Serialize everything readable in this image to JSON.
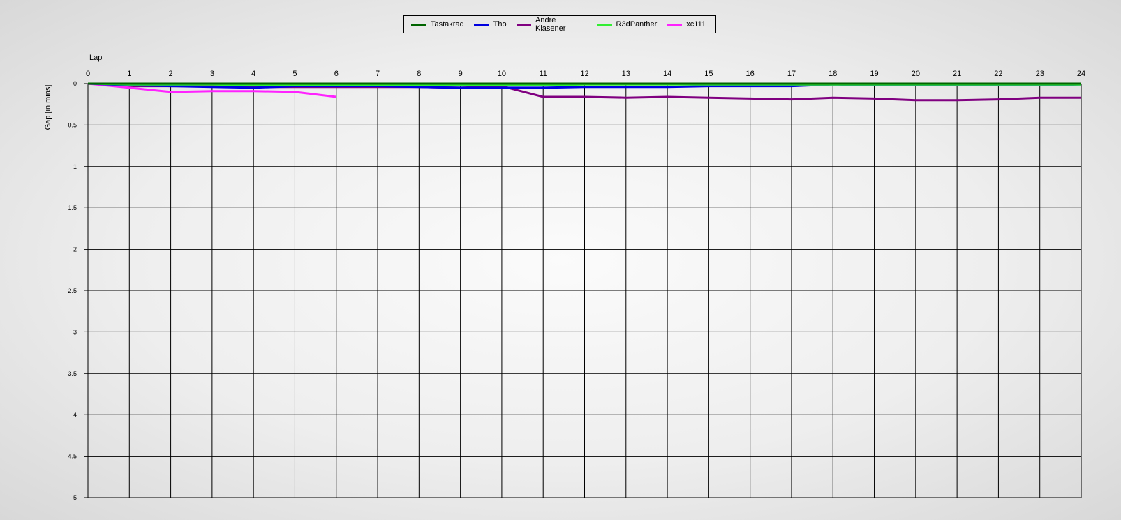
{
  "chart_data": {
    "type": "line",
    "xlabel": "Lap",
    "ylabel": "Gap [in mins]",
    "x_ticks": [
      0,
      1,
      2,
      3,
      4,
      5,
      6,
      7,
      8,
      9,
      10,
      11,
      12,
      13,
      14,
      15,
      16,
      17,
      18,
      19,
      20,
      21,
      22,
      23,
      24
    ],
    "x_tick_labels": [
      "0",
      "1",
      "2",
      "3",
      "4",
      "5",
      "6",
      "7",
      "8",
      "9",
      "10",
      "11",
      "12",
      "13",
      "14",
      "15",
      "16",
      "17",
      "18",
      "19",
      "20",
      "21",
      "22",
      "23",
      "24"
    ],
    "y_ticks": [
      0,
      0.5,
      1,
      1.5,
      2,
      2.5,
      3,
      3.5,
      4,
      4.5,
      5
    ],
    "y_tick_labels": [
      "0",
      "0.5",
      "1",
      "1.5",
      "2",
      "2.5",
      "3",
      "3.5",
      "4",
      "4.5",
      "5"
    ],
    "xlim": [
      0,
      24
    ],
    "ylim": [
      0,
      5
    ],
    "y_inverted": true,
    "grid": true,
    "legend_position": "top-center",
    "series": [
      {
        "name": "Tastakrad",
        "color": "#006400",
        "x": [
          0,
          1,
          2,
          3,
          4,
          5,
          6,
          7,
          8,
          9,
          10,
          11,
          12,
          13,
          14,
          15,
          16,
          17,
          18,
          19,
          20,
          21,
          22,
          23,
          24
        ],
        "values": [
          0,
          0,
          0,
          0,
          0,
          0,
          0,
          0,
          0,
          0,
          0,
          0,
          0,
          0,
          0,
          0,
          0,
          0,
          0,
          0,
          0,
          0,
          0,
          0,
          0
        ]
      },
      {
        "name": "Tho",
        "color": "#0000e0",
        "x": [
          0,
          1,
          2,
          3,
          4,
          5,
          6,
          7,
          8,
          9,
          10,
          11,
          12,
          13,
          14,
          15,
          16,
          17,
          18,
          19,
          20,
          21,
          22,
          23,
          24
        ],
        "values": [
          0,
          0.02,
          0.03,
          0.04,
          0.05,
          0.03,
          0.03,
          0.03,
          0.04,
          0.05,
          0.05,
          0.05,
          0.04,
          0.04,
          0.04,
          0.03,
          0.03,
          0.03,
          0.01,
          0.02,
          0.02,
          0.02,
          0.02,
          0.02,
          0.01
        ]
      },
      {
        "name": "Andre Klasener",
        "color": "#800080",
        "x": [
          0,
          1,
          2,
          3,
          4,
          5,
          6,
          7,
          8,
          9,
          10,
          11,
          12,
          13,
          14,
          15,
          16,
          17,
          18,
          19,
          20,
          21,
          22,
          23,
          24
        ],
        "values": [
          0,
          0.03,
          0.03,
          0.03,
          0.04,
          0.04,
          0.04,
          0.04,
          0.04,
          0.05,
          0.03,
          0.16,
          0.16,
          0.17,
          0.16,
          0.17,
          0.18,
          0.19,
          0.17,
          0.18,
          0.2,
          0.2,
          0.19,
          0.17,
          0.17
        ]
      },
      {
        "name": "R3dPanther",
        "color": "#33ee33",
        "x": [
          0,
          1,
          2,
          3,
          4,
          5,
          6,
          7,
          8,
          9,
          10,
          11,
          12,
          13,
          14,
          15,
          16,
          17,
          18,
          19,
          20,
          21,
          22,
          23,
          24
        ],
        "values": [
          0,
          0.01,
          0.01,
          0.01,
          0.02,
          0.02,
          0.02,
          0.02,
          0.02,
          0.02,
          0.02,
          0.02,
          0.01,
          0.01,
          0.01,
          0.01,
          0.01,
          0.01,
          0.01,
          0.01,
          0.01,
          0.01,
          0.01,
          0.01,
          0.01
        ]
      },
      {
        "name": "xc111",
        "color": "#ff22ff",
        "x": [
          0,
          1,
          2,
          3,
          4,
          5,
          6
        ],
        "values": [
          0,
          0.05,
          0.1,
          0.09,
          0.09,
          0.1,
          0.16
        ]
      }
    ]
  }
}
